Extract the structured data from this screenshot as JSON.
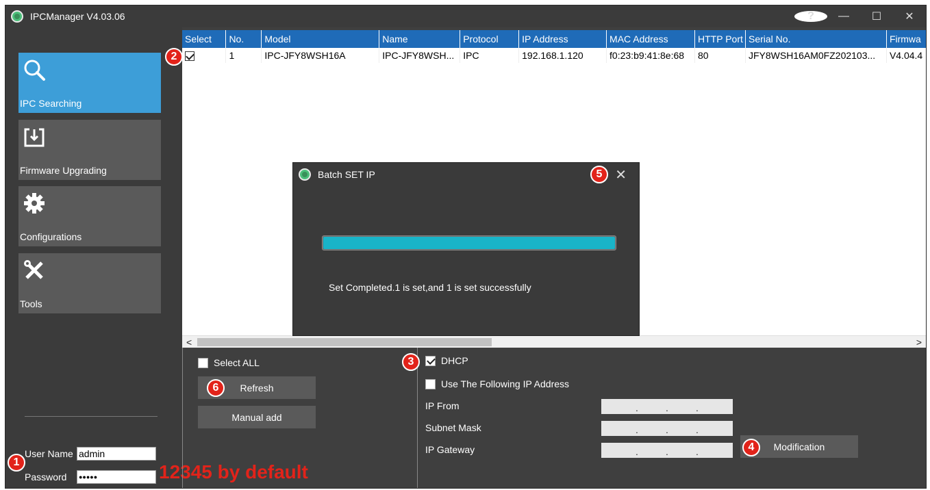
{
  "app": {
    "title": "IPCManager V4.03.06",
    "help_icon": "?"
  },
  "window_controls": {
    "minimize": "—",
    "maximize": "☐",
    "close": "✕"
  },
  "sidebar": {
    "items": [
      {
        "label": "IPC Searching",
        "icon": "search-icon",
        "active": true
      },
      {
        "label": "Firmware Upgrading",
        "icon": "upload-icon",
        "active": false
      },
      {
        "label": "Configurations",
        "icon": "gear-icon",
        "active": false
      },
      {
        "label": "Tools",
        "icon": "tools-icon",
        "active": false
      }
    ],
    "user_name_label": "User Name",
    "user_name_value": "admin",
    "password_label": "Password",
    "password_value": "●●●●●"
  },
  "annotation_hint": "12345 by default",
  "table": {
    "columns": [
      "Select",
      "No.",
      "Model",
      "Name",
      "Protocol",
      "IP Address",
      "MAC Address",
      "HTTP Port",
      "Serial No.",
      "Firmwa"
    ],
    "rows": [
      {
        "selected": true,
        "cells": [
          "",
          "1",
          "IPC-JFY8WSH16A",
          "IPC-JFY8WSH...",
          "IPC",
          "192.168.1.120",
          "f0:23:b9:41:8e:68",
          "80",
          "JFY8WSH16AM0FZ202103...",
          "V4.04.4"
        ]
      }
    ],
    "scroll_left": "<",
    "scroll_right": ">"
  },
  "controls": {
    "select_all_label": "Select ALL",
    "refresh_label": "Refresh",
    "manual_add_label": "Manual add",
    "dhcp_label": "DHCP",
    "dhcp_checked": true,
    "use_following_label": "Use The Following IP Address",
    "ip_from_label": "IP From",
    "subnet_mask_label": "Subnet Mask",
    "ip_gateway_label": "IP Gateway",
    "ip_placeholder": ".        .        .",
    "modification_label": "Modification"
  },
  "dialog": {
    "title": "Batch SET IP",
    "close": "✕",
    "progress": 1.0,
    "message": "Set Completed.1 is set,and 1 is set successfully"
  },
  "badges": [
    "1",
    "2",
    "3",
    "4",
    "5",
    "6"
  ],
  "colors": {
    "accent": "#3d9ed8",
    "header": "#1f6bb8",
    "progress": "#19b4c8",
    "badge": "#e2231a"
  }
}
